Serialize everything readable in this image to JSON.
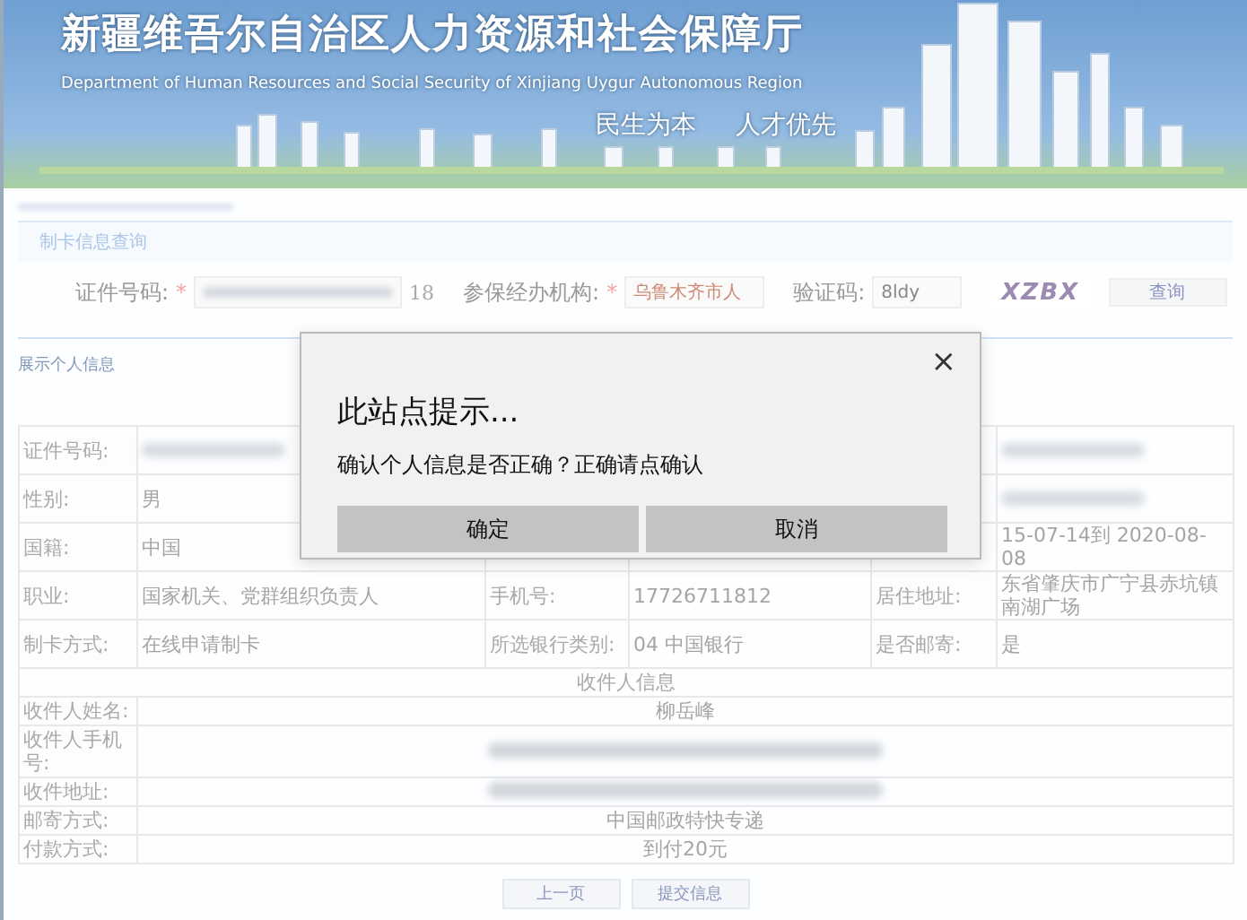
{
  "header": {
    "title": "新疆维吾尔自治区人力资源和社会保障厅",
    "subtitle": "Department of Human Resources and Social Security of Xinjiang Uygur Autonomous Region",
    "slogans": [
      "民生为本",
      "人才优先"
    ]
  },
  "query": {
    "title": "制卡信息查询",
    "fields": [
      {
        "kind": "id",
        "label": "证件号码:",
        "required_mark": "*",
        "suffix": "18"
      },
      {
        "kind": "select",
        "label": "参保经办机构:",
        "required_mark": "*",
        "value": "乌鲁木齐市人"
      },
      {
        "kind": "text",
        "label": "验证码:",
        "value": "8ldy"
      }
    ],
    "captcha": "XZBX",
    "button": "查询"
  },
  "info": {
    "title": "展示个人信息",
    "rows": [
      {
        "kind": "grid",
        "cells": [
          {
            "kind": "label",
            "text": "证件号码:"
          },
          {
            "kind": "blurred"
          },
          {
            "kind": "blank"
          },
          {
            "kind": "blank"
          },
          {
            "kind": "blank"
          },
          {
            "kind": "blurred"
          }
        ]
      },
      {
        "kind": "grid",
        "cells": [
          {
            "kind": "label",
            "text": "性别:"
          },
          {
            "kind": "value",
            "text": "男"
          },
          {
            "kind": "blank"
          },
          {
            "kind": "blank"
          },
          {
            "kind": "blank"
          },
          {
            "kind": "blurred"
          }
        ]
      },
      {
        "kind": "grid",
        "cells": [
          {
            "kind": "label",
            "text": "国籍:"
          },
          {
            "kind": "value",
            "text": "中国"
          },
          {
            "kind": "blank"
          },
          {
            "kind": "blank"
          },
          {
            "kind": "blank"
          },
          {
            "kind": "value",
            "text": "15-07-14到 2020-08-08"
          }
        ]
      },
      {
        "kind": "grid",
        "cells": [
          {
            "kind": "label",
            "text": "职业:"
          },
          {
            "kind": "value",
            "text": "国家机关、党群组织负责人"
          },
          {
            "kind": "label",
            "text": "手机号:"
          },
          {
            "kind": "value",
            "text": "17726711812"
          },
          {
            "kind": "label",
            "text": "居住地址:"
          },
          {
            "kind": "value",
            "text": "东省肇庆市广宁县赤坑镇南湖广场"
          }
        ]
      },
      {
        "kind": "grid",
        "cells": [
          {
            "kind": "label",
            "text": "制卡方式:"
          },
          {
            "kind": "value",
            "text": "在线申请制卡"
          },
          {
            "kind": "label",
            "text": "所选银行类别:"
          },
          {
            "kind": "value",
            "text": "04 中国银行"
          },
          {
            "kind": "label",
            "text": "是否邮寄:"
          },
          {
            "kind": "value",
            "text": "是"
          }
        ]
      },
      {
        "kind": "heading",
        "text": "收件人信息"
      },
      {
        "kind": "wide",
        "label": "收件人姓名:",
        "value": "柳岳峰"
      },
      {
        "kind": "wide",
        "label": "收件人手机号:",
        "blurred": true
      },
      {
        "kind": "wide",
        "label": "收件地址:",
        "blurred": true
      },
      {
        "kind": "wide",
        "label": "邮寄方式:",
        "value": "中国邮政特快专递"
      },
      {
        "kind": "wide",
        "label": "付款方式:",
        "value": "到付20元"
      }
    ]
  },
  "buttons": [
    "上一页",
    "提交信息"
  ],
  "dialog": {
    "title": "此站点提示...",
    "message": "确认个人信息是否正确？正确请点确认",
    "close": "×",
    "buttons": [
      "确定",
      "取消"
    ]
  }
}
